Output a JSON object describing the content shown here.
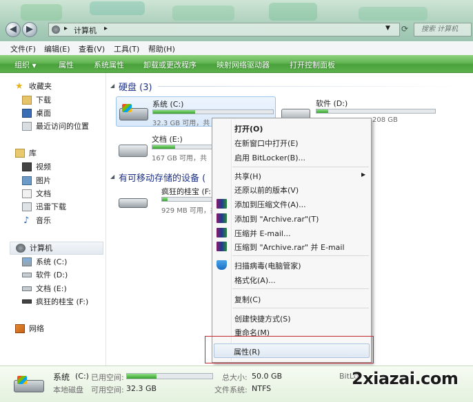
{
  "address": {
    "crumb": "计算机"
  },
  "search": {
    "placeholder": "搜索 计算机"
  },
  "menubar": [
    "文件(F)",
    "编辑(E)",
    "查看(V)",
    "工具(T)",
    "帮助(H)"
  ],
  "commandbar": [
    "组织",
    "属性",
    "系统属性",
    "卸载或更改程序",
    "映射网络驱动器",
    "打开控制面板"
  ],
  "nav": {
    "favorites": {
      "title": "收藏夹",
      "items": [
        "下载",
        "桌面",
        "最近访问的位置"
      ]
    },
    "libraries": {
      "title": "库",
      "items": [
        "视频",
        "图片",
        "文档",
        "迅雷下载",
        "音乐"
      ]
    },
    "computer": {
      "title": "计算机",
      "items": [
        "系统 (C:)",
        "软件 (D:)",
        "文档 (E:)",
        "疯狂的桂宝 (F:)"
      ]
    },
    "network": {
      "title": "网络"
    }
  },
  "content": {
    "hdd_group": "硬盘 (3)",
    "removable_group": "有可移动存储的设备 (",
    "drives": [
      {
        "name": "系统 (C:)",
        "info": "32.3 GB 可用，共",
        "fill": 0.35
      },
      {
        "name": "软件 (D:)",
        "info": "208 GB",
        "fill": 0.1
      },
      {
        "name": "文档 (E:)",
        "info": "167 GB 可用，共",
        "fill": 0.4
      },
      {
        "name": "疯狂的桂宝 (F:)",
        "info": "929 MB 可用，共 2",
        "fill": 0.45
      }
    ]
  },
  "context_menu": {
    "open": "打开(O)",
    "open_new_window": "在新窗口中打开(E)",
    "bitlocker": "启用 BitLocker(B)...",
    "share": "共享(H)",
    "restore": "还原以前的版本(V)",
    "add_archive": "添加到压缩文件(A)...",
    "add_rar": "添加到 \"Archive.rar\"(T)",
    "compress_email": "压缩并 E-mail...",
    "compress_rar_email": "压缩到 \"Archive.rar\" 并 E-mail",
    "scan": "扫描病毒(电脑管家)",
    "format": "格式化(A)...",
    "copy": "复制(C)",
    "shortcut": "创建快捷方式(S)",
    "rename": "重命名(M)",
    "properties": "属性(R)"
  },
  "details": {
    "drive_name": "系统",
    "drive_letter": "(C:)",
    "used_label": "已用空间:",
    "type": "本地磁盘",
    "free_label": "可用空间:",
    "free_value": "32.3 GB",
    "used_fill": 0.35,
    "total_label": "总大小:",
    "total_value": "50.0 GB",
    "fs_label": "文件系统:",
    "fs_value": "NTFS",
    "bitlocker": "BitLo"
  },
  "watermark": "2xiazai.com"
}
